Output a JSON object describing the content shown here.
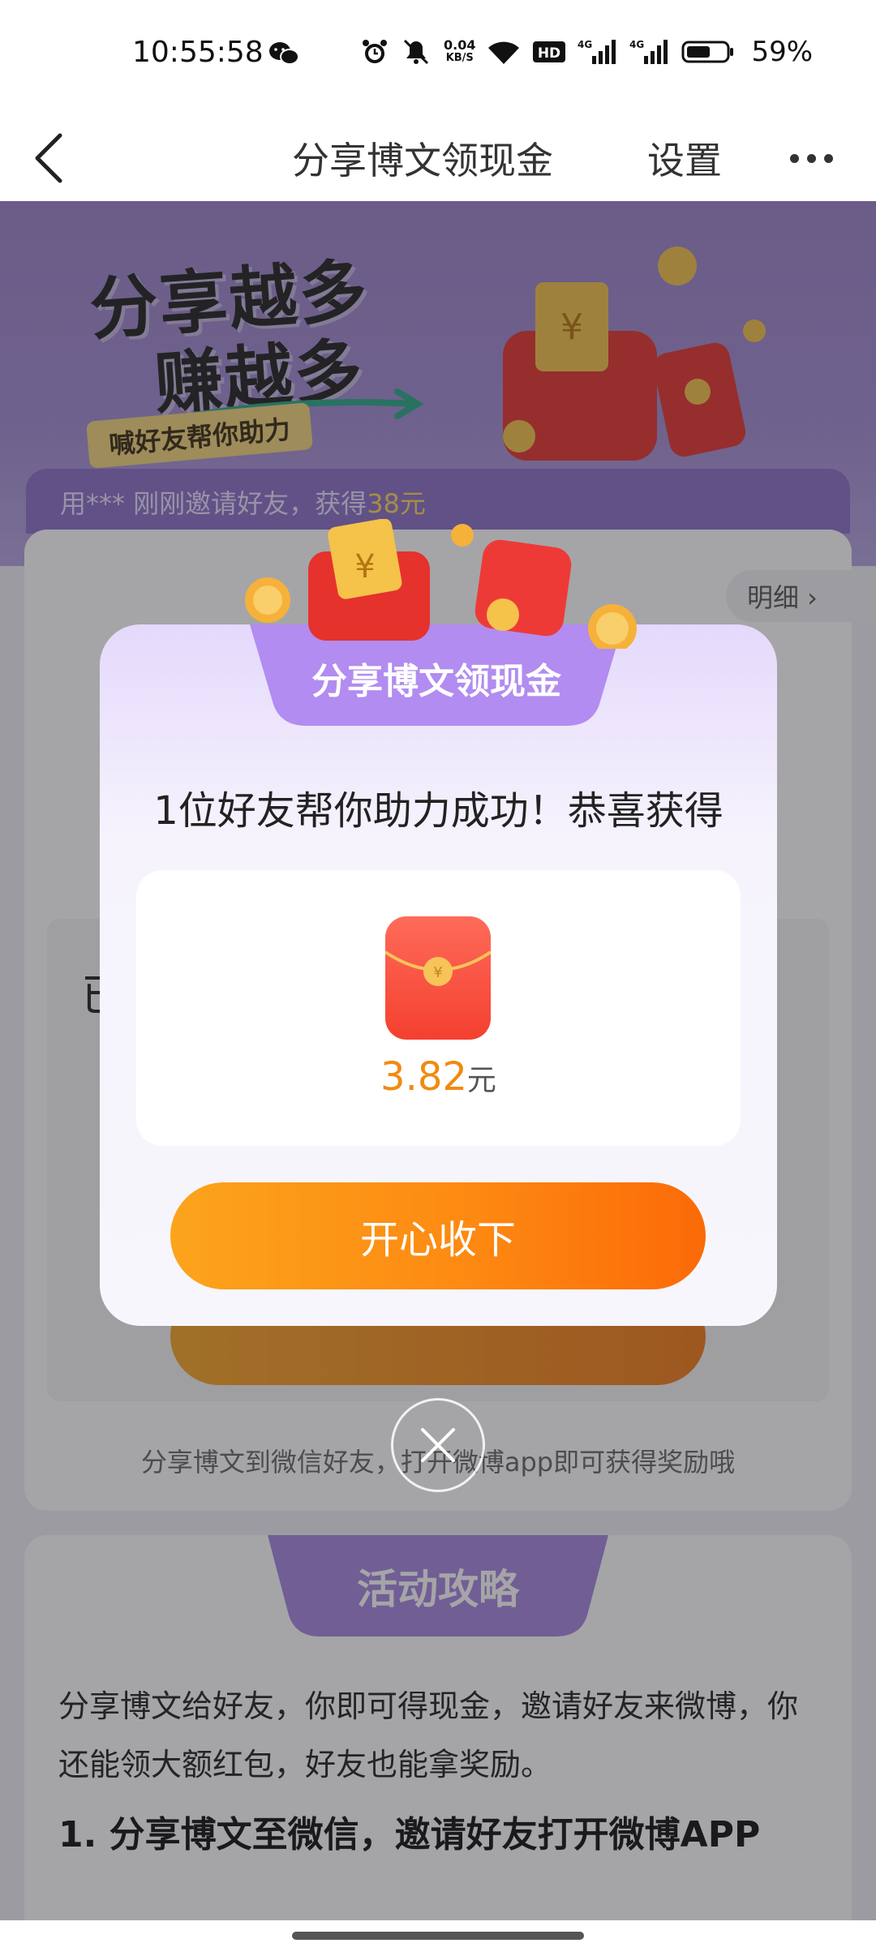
{
  "status_bar": {
    "time": "10:55:58",
    "net_speed_value": "0.04",
    "net_speed_unit": "KB/S",
    "hd_label": "HD",
    "sim1_label": "4G",
    "sim2_label": "4G",
    "battery_percent": "59%",
    "icons": [
      "wechat-icon",
      "alarm-icon",
      "mute-icon",
      "wifi-icon",
      "hd-icon",
      "signal-icon",
      "signal-icon",
      "battery-icon"
    ]
  },
  "nav": {
    "title": "分享博文领现金",
    "settings": "设置",
    "back_icon": "chevron-left-icon",
    "more_icon": "more-dots-icon"
  },
  "banner": {
    "slogan_line1": "分享越多",
    "slogan_line2": "赚越多",
    "tag": "喊好友帮你助力",
    "ticker_prefix": "用*** 刚刚邀请好友，获得",
    "ticker_amount": "38元"
  },
  "main_card": {
    "details_label": "明细 ›",
    "partial_text": "已",
    "footnote": "分享博文到微信好友，打开微博app即可获得奖励哦"
  },
  "guide": {
    "tab_label": "活动攻略",
    "paragraph": "分享博文给好友，你即可得现金，邀请好友来微博，你还能领大额红包，好友也能拿奖励。",
    "step1": "1. 分享博文至微信，邀请好友打开微博APP"
  },
  "modal": {
    "tab_label": "分享博文领现金",
    "message": "1位好友帮你助力成功！恭喜获得",
    "reward_value": "3.82",
    "reward_unit": "元",
    "accept_label": "开心收下",
    "close_icon": "close-icon"
  },
  "colors": {
    "accent_orange": "#fd8a12",
    "purple": "#9d82c9",
    "amount_orange": "#f08a12"
  }
}
